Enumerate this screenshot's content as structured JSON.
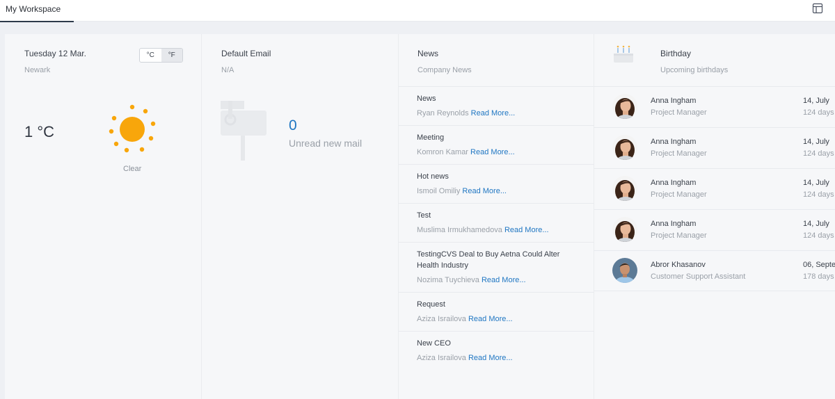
{
  "tabs": [
    {
      "label": "My Workspace"
    }
  ],
  "weather": {
    "date": "Tuesday 12 Mar.",
    "city": "Newark",
    "unit_c": "°C",
    "unit_f": "°F",
    "temperature": "1 °C",
    "condition": "Clear",
    "icon": "sun-icon",
    "sun_color": "#f8a60b"
  },
  "email": {
    "title": "Default Email",
    "address": "N/A",
    "unread_count": "0",
    "unread_label": "Unread new mail",
    "icon": "mailbox-icon"
  },
  "news": {
    "title": "News",
    "subtitle": "Company News",
    "read_more": "Read More...",
    "items": [
      {
        "title": "News",
        "author": "Ryan Reynolds"
      },
      {
        "title": "Meeting",
        "author": "Komron Kamar"
      },
      {
        "title": "Hot news",
        "author": "Ismoil Omiliy"
      },
      {
        "title": "Test",
        "author": "Muslima Irmukhamedova"
      },
      {
        "title": "TestingCVS Deal to Buy Aetna Could Alter Health Industry",
        "author": "Nozima Tuychieva"
      },
      {
        "title": "Request",
        "author": "Aziza Israilova"
      },
      {
        "title": "New CEO",
        "author": "Aziza Israilova"
      }
    ]
  },
  "birthday": {
    "title": "Birthday",
    "subtitle": "Upcoming birthdays",
    "icon": "cake-icon",
    "people": [
      {
        "name": "Anna Ingham",
        "role": "Project Manager",
        "date": "14, July",
        "days": "124 days l"
      },
      {
        "name": "Anna Ingham",
        "role": "Project Manager",
        "date": "14, July",
        "days": "124 days l"
      },
      {
        "name": "Anna Ingham",
        "role": "Project Manager",
        "date": "14, July",
        "days": "124 days l"
      },
      {
        "name": "Anna Ingham",
        "role": "Project Manager",
        "date": "14, July",
        "days": "124 days l"
      },
      {
        "name": "Abror Khasanov",
        "role": "Customer Support Assistant",
        "date": "06, Septe",
        "days": "178 days l"
      }
    ]
  },
  "colors": {
    "accent": "#1f76c2",
    "tab_underline": "#2d3a4a"
  }
}
